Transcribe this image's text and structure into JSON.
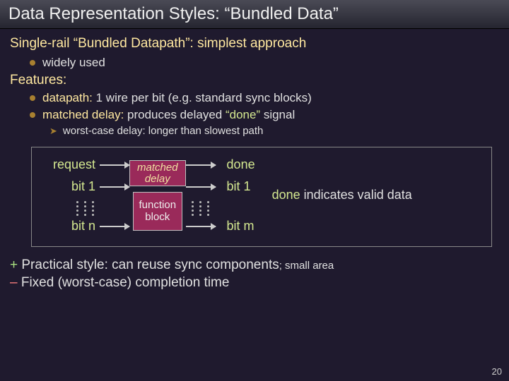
{
  "title": "Data Representation Styles: “Bundled Data”",
  "subtitle": "Single-rail “Bundled Datapath”: simplest approach",
  "bullets": {
    "widely": "widely used",
    "datapath_kw": "datapath:",
    "datapath_rest": " 1 wire per bit (e.g. standard sync blocks)",
    "matched_kw": "matched delay:",
    "matched_rest": "  produces delayed ",
    "done_q": "“done”",
    "matched_tail": " signal",
    "worst": "worst-case delay: longer than slowest path"
  },
  "features_label": "Features:",
  "diagram": {
    "request": "request",
    "bit1": "bit 1",
    "bitn": "bit n",
    "matched": "matched",
    "delay": "delay",
    "function": "function",
    "block": "block",
    "done": "done",
    "bit1r": "bit 1",
    "bitm": "bit m",
    "note_done": "done",
    "note_rest": " indicates valid data"
  },
  "bottom": {
    "plus_sym": "+",
    "plus_text": " Practical style: can reuse sync components",
    "plus_small": "; small area",
    "minus_sym": "–",
    "minus_text": " Fixed (worst-case) completion time"
  },
  "page": "20"
}
